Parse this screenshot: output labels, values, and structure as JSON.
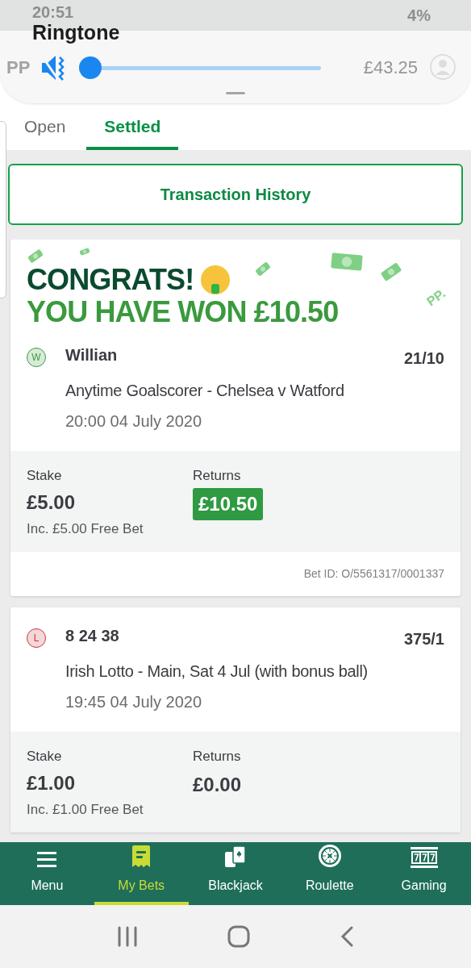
{
  "status_bar": {
    "time": "20:51",
    "battery": "4%"
  },
  "volume_panel": {
    "title": "Ringtone",
    "muted": true,
    "level": 0
  },
  "header": {
    "logo": "PP",
    "balance": "£43.25"
  },
  "tabs": [
    {
      "label": "Open",
      "selected": false
    },
    {
      "label": "Settled",
      "selected": true
    }
  ],
  "transaction_button": "Transaction History",
  "bets": [
    {
      "banner": {
        "line1": "CONGRATS!",
        "line2": "YOU HAVE WON £10.50",
        "mark": "PP."
      },
      "result": "W",
      "color": "#3a9a3e",
      "selection": "Willian",
      "odds": "21/10",
      "market": "Anytime Goalscorer - Chelsea v Watford",
      "date": "20:00 04 July 2020",
      "stake_label": "Stake",
      "stake": "£5.00",
      "free_bet": "Inc. £5.00 Free Bet",
      "returns_label": "Returns",
      "returns": "£10.50",
      "returns_highlight": true,
      "bet_id": "Bet ID: O/5561317/0001337"
    },
    {
      "result": "L",
      "color": "#c8363c",
      "selection": "8 24 38",
      "odds": "375/1",
      "market": "Irish Lotto - Main, Sat 4 Jul (with bonus ball)",
      "date": "19:45 04 July 2020",
      "stake_label": "Stake",
      "stake": "£1.00",
      "free_bet": "Inc. £1.00 Free Bet",
      "returns_label": "Returns",
      "returns": "£0.00",
      "returns_highlight": false
    }
  ],
  "bottom_nav": [
    {
      "label": "Menu",
      "kind": "menu",
      "selected": false
    },
    {
      "label": "My Bets",
      "kind": "bets",
      "selected": true
    },
    {
      "label": "Blackjack",
      "kind": "cards",
      "selected": false
    },
    {
      "label": "Roulette",
      "kind": "roulette",
      "selected": false
    },
    {
      "label": "Gaming",
      "kind": "slots",
      "selected": false
    }
  ]
}
